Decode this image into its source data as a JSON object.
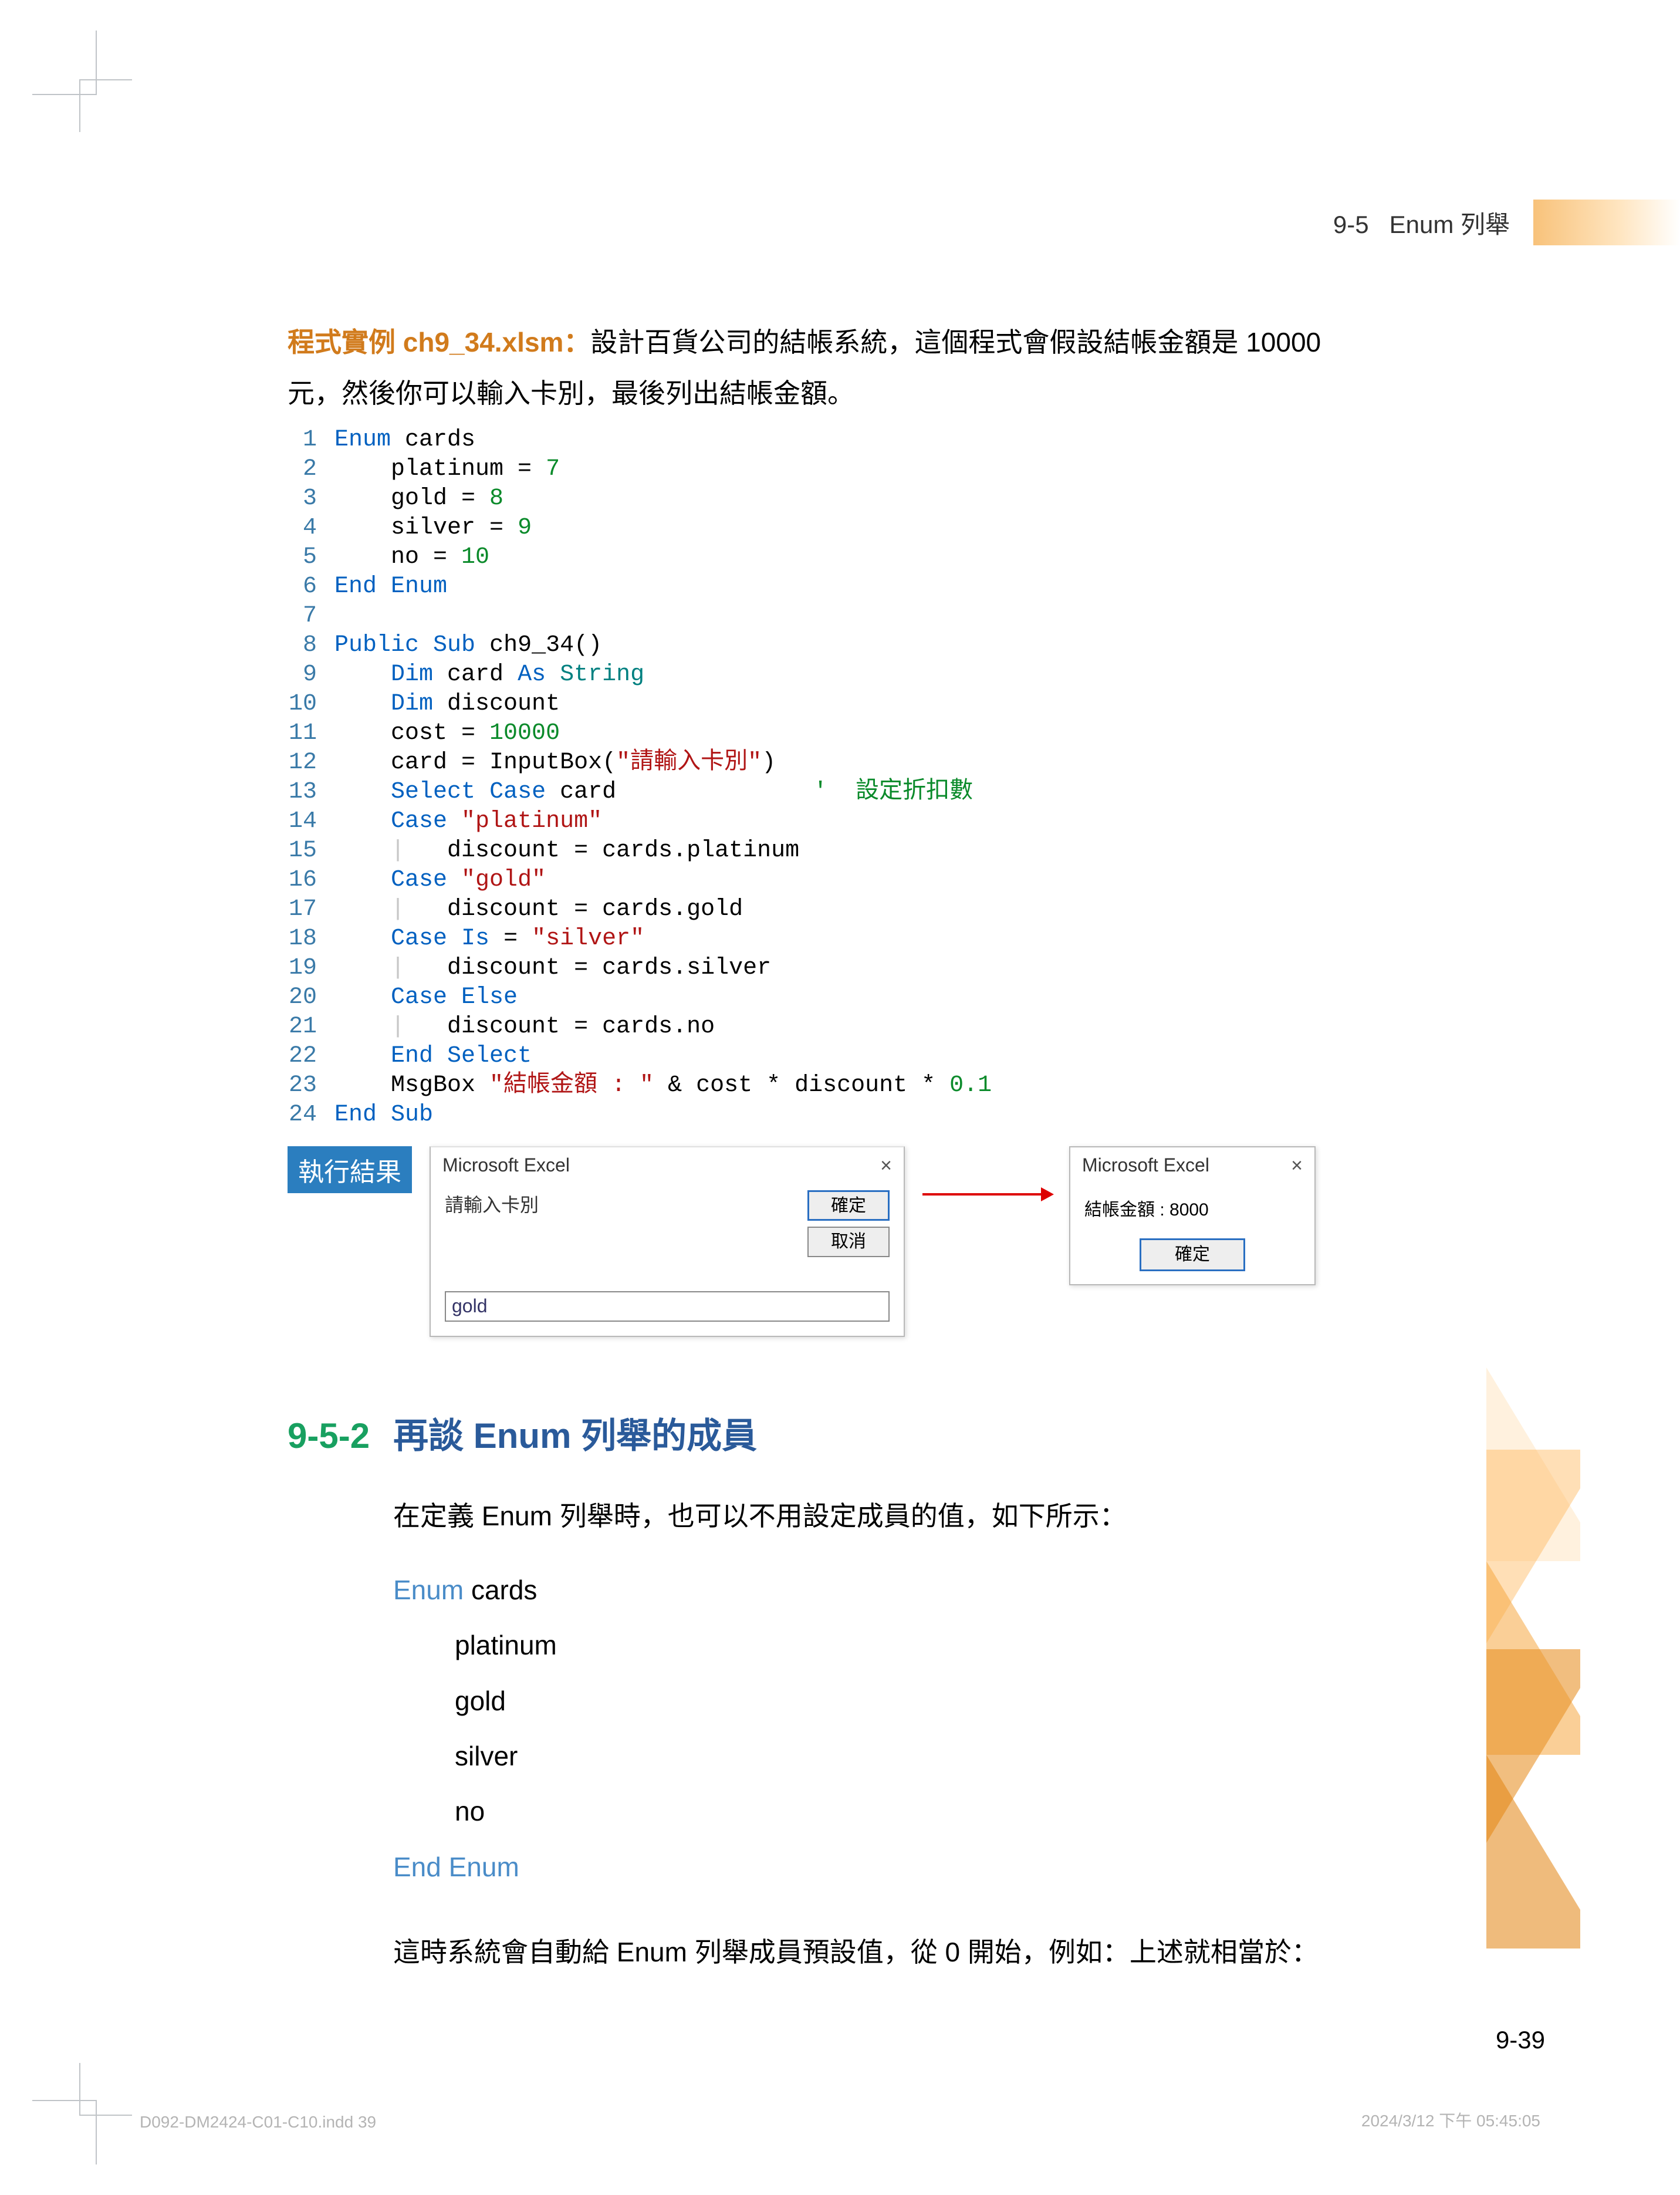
{
  "header": {
    "section": "9-5",
    "title": "Enum 列舉"
  },
  "intro": {
    "label": "程式實例 ch9_34.xlsm：",
    "line1": "設計百貨公司的結帳系統，這個程式會假設結帳金額是 10000",
    "line2": "元，然後你可以輸入卡別，最後列出結帳金額。"
  },
  "code": {
    "l1a": "Enum",
    "l1b": " cards",
    "l2a": "platinum = ",
    "l2n": "7",
    "l3a": "gold = ",
    "l3n": "8",
    "l4a": "silver = ",
    "l4n": "9",
    "l5a": "no = ",
    "l5n": "10",
    "l6": "End Enum",
    "l8a": "Public",
    "l8b": "Sub",
    "l8c": " ch9_34()",
    "l9a": "Dim",
    "l9b": " card ",
    "l9c": "As",
    "l9d": "String",
    "l10a": "Dim",
    "l10b": " discount",
    "l11a": "cost = ",
    "l11n": "10000",
    "l12a": "card = InputBox(",
    "l12s": "\"請輸入卡別\"",
    "l12b": ")",
    "l13a": "Select",
    "l13b": "Case",
    "l13c": " card",
    "l13cmt": "'  設定折扣數",
    "l14a": "Case",
    "l14s": "\"platinum\"",
    "l15": "discount = cards.platinum",
    "l16a": "Case",
    "l16s": "\"gold\"",
    "l17": "discount = cards.gold",
    "l18a": "Case",
    "l18b": "Is",
    "l18c": " = ",
    "l18s": "\"silver\"",
    "l19": "discount = cards.silver",
    "l20a": "Case",
    "l20b": "Else",
    "l21": "discount = cards.no",
    "l22": "End Select",
    "l23a": "MsgBox ",
    "l23s": "\"結帳金額 : \"",
    "l23b": " & cost * discount * ",
    "l23n": "0.1",
    "l24": "End Sub",
    "ln": [
      "1",
      "2",
      "3",
      "4",
      "5",
      "6",
      "7",
      "8",
      "9",
      "10",
      "11",
      "12",
      "13",
      "14",
      "15",
      "16",
      "17",
      "18",
      "19",
      "20",
      "21",
      "22",
      "23",
      "24"
    ]
  },
  "result": {
    "label": "執行結果",
    "d1_title": "Microsoft Excel",
    "d1_prompt": "請輸入卡別",
    "d1_ok": "確定",
    "d1_cancel": "取消",
    "d1_input": "gold",
    "d2_title": "Microsoft Excel",
    "d2_msg": "結帳金額 : 8000",
    "d2_ok": "確定"
  },
  "section": {
    "num": "9-5-2",
    "title": "再談 Enum 列舉的成員"
  },
  "body1": "在定義 Enum 列舉時，也可以不用設定成員的值，如下所示：",
  "enum2": {
    "kw1": "Enum",
    "name": " cards",
    "m1": "platinum",
    "m2": "gold",
    "m3": "silver",
    "m4": "no",
    "kw2": "End Enum"
  },
  "body2": "這時系統會自動給 Enum 列舉成員預設值，從 0 開始，例如：上述就相當於：",
  "page_num": "9-39",
  "foot_left": "D092-DM2424-C01-C10.indd   39",
  "foot_right": "2024/3/12   下午 05:45:05"
}
